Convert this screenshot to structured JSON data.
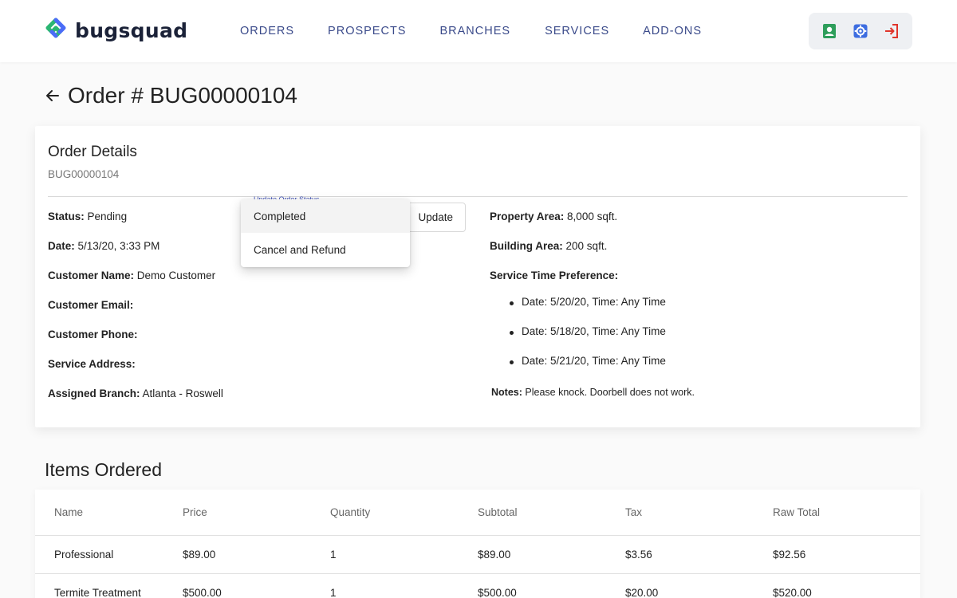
{
  "brand": {
    "name": "bugsquad"
  },
  "nav": {
    "items": [
      {
        "label": "ORDERS"
      },
      {
        "label": "PROSPECTS"
      },
      {
        "label": "BRANCHES"
      },
      {
        "label": "SERVICES"
      },
      {
        "label": "ADD-ONS"
      }
    ]
  },
  "toolbar": {
    "icons": [
      "contact-card-icon",
      "settings-gear-icon",
      "logout-icon"
    ]
  },
  "page": {
    "title": "Order # BUG00000104"
  },
  "order": {
    "card_title": "Order Details",
    "card_subtitle": "BUG00000104",
    "status_label": "Status:",
    "status_value": "Pending",
    "status_select_label": "Update Order Status",
    "update_button": "Update",
    "status_menu": [
      "Completed",
      "Cancel and Refund"
    ],
    "date_label": "Date:",
    "date_value": "5/13/20, 3:33 PM",
    "customer_name_label": "Customer Name:",
    "customer_name_value": "Demo Customer",
    "customer_email_label": "Customer Email:",
    "customer_phone_label": "Customer Phone:",
    "service_address_label": "Service Address:",
    "assigned_branch_label": "Assigned Branch:",
    "assigned_branch_value": "Atlanta - Roswell",
    "property_area_label": "Property Area:",
    "property_area_value": "8,000 sqft.",
    "building_area_label": "Building Area:",
    "building_area_value": "200 sqft.",
    "service_time_label": "Service Time Preference:",
    "service_time_prefs": [
      "Date: 5/20/20, Time: Any Time",
      "Date: 5/18/20, Time: Any Time",
      "Date: 5/21/20, Time: Any Time"
    ],
    "notes_label": "Notes:",
    "notes_value": "Please knock. Doorbell does not work."
  },
  "items_ordered": {
    "title": "Items Ordered",
    "columns": [
      "Name",
      "Price",
      "Quantity",
      "Subtotal",
      "Tax",
      "Raw Total"
    ],
    "rows": [
      [
        "Professional",
        "$89.00",
        "1",
        "$89.00",
        "$3.56",
        "$92.56"
      ],
      [
        "Termite Treatment",
        "$500.00",
        "1",
        "$500.00",
        "$20.00",
        "$520.00"
      ]
    ]
  },
  "colors": {
    "nav_text": "#3a4a8a",
    "logo_green": "#2bb673",
    "logo_blue": "#4a6cf7",
    "icon_green": "#2e9e5b",
    "icon_blue": "#3d6de0",
    "icon_red": "#e0352b"
  }
}
